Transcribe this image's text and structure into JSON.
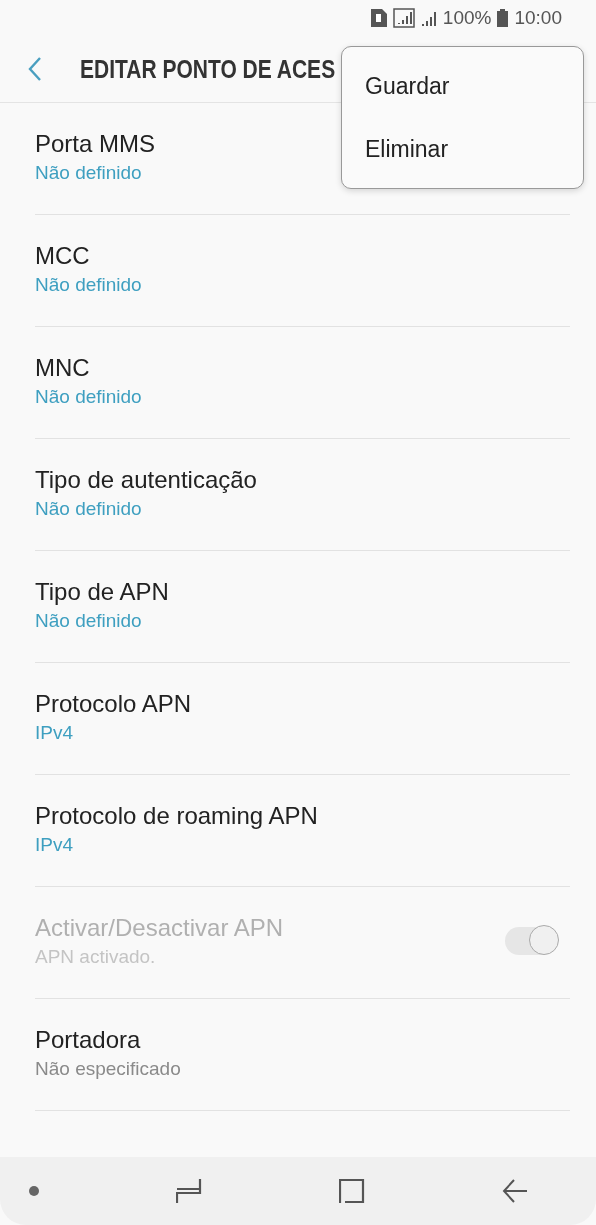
{
  "status_bar": {
    "battery": "100%",
    "time": "10:00"
  },
  "header": {
    "title": "EDITAR PONTO DE ACES"
  },
  "menu": {
    "items": [
      {
        "label": "Guardar"
      },
      {
        "label": "Eliminar"
      }
    ]
  },
  "settings": [
    {
      "kind": "setting",
      "title": "Porta MMS",
      "summary": "Não definido",
      "color": "#3e9fc0",
      "disabled": false
    },
    {
      "kind": "setting",
      "title": "MCC",
      "summary": "Não definido",
      "color": "#3e9fc0",
      "disabled": false
    },
    {
      "kind": "setting",
      "title": "MNC",
      "summary": "Não definido",
      "color": "#3e9fc0",
      "disabled": false
    },
    {
      "kind": "setting",
      "title": "Tipo de autenticação",
      "summary": "Não definido",
      "color": "#3e9fc0",
      "disabled": false
    },
    {
      "kind": "setting",
      "title": "Tipo de APN",
      "summary": "Não definido",
      "color": "#3e9fc0",
      "disabled": false
    },
    {
      "kind": "setting",
      "title": "Protocolo APN",
      "summary": "IPv4",
      "color": "#3e9fc0",
      "disabled": false
    },
    {
      "kind": "setting",
      "title": "Protocolo de roaming APN",
      "summary": "IPv4",
      "color": "#3e9fc0",
      "disabled": false
    },
    {
      "kind": "toggle",
      "title": "Activar/Desactivar APN",
      "summary": "APN activado.",
      "color": "#c4c4c4",
      "disabled": true,
      "on": true
    },
    {
      "kind": "setting",
      "title": "Portadora",
      "summary": "Não especificado",
      "color": "#8a8a8a",
      "disabled": false
    }
  ]
}
